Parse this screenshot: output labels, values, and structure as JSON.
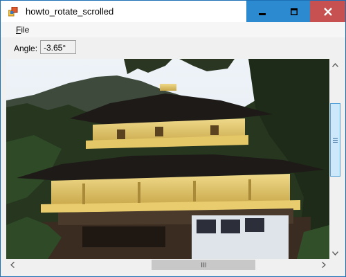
{
  "window": {
    "title": "howto_rotate_scrolled"
  },
  "menu": {
    "file_label": "File",
    "file_mnemonic": "F",
    "file_rest": "ile"
  },
  "controls": {
    "angle_label": "Angle:",
    "angle_value": "-3.65°"
  },
  "image": {
    "description_icon": "rotated-photo"
  },
  "icons": {
    "app": "app-icon",
    "minimize": "minimize-icon",
    "maximize": "maximize-icon",
    "close": "close-icon"
  },
  "colors": {
    "title_buttons": "#2b8ad0",
    "close_button": "#c75050",
    "scroll_thumb": "#cde8fa"
  }
}
